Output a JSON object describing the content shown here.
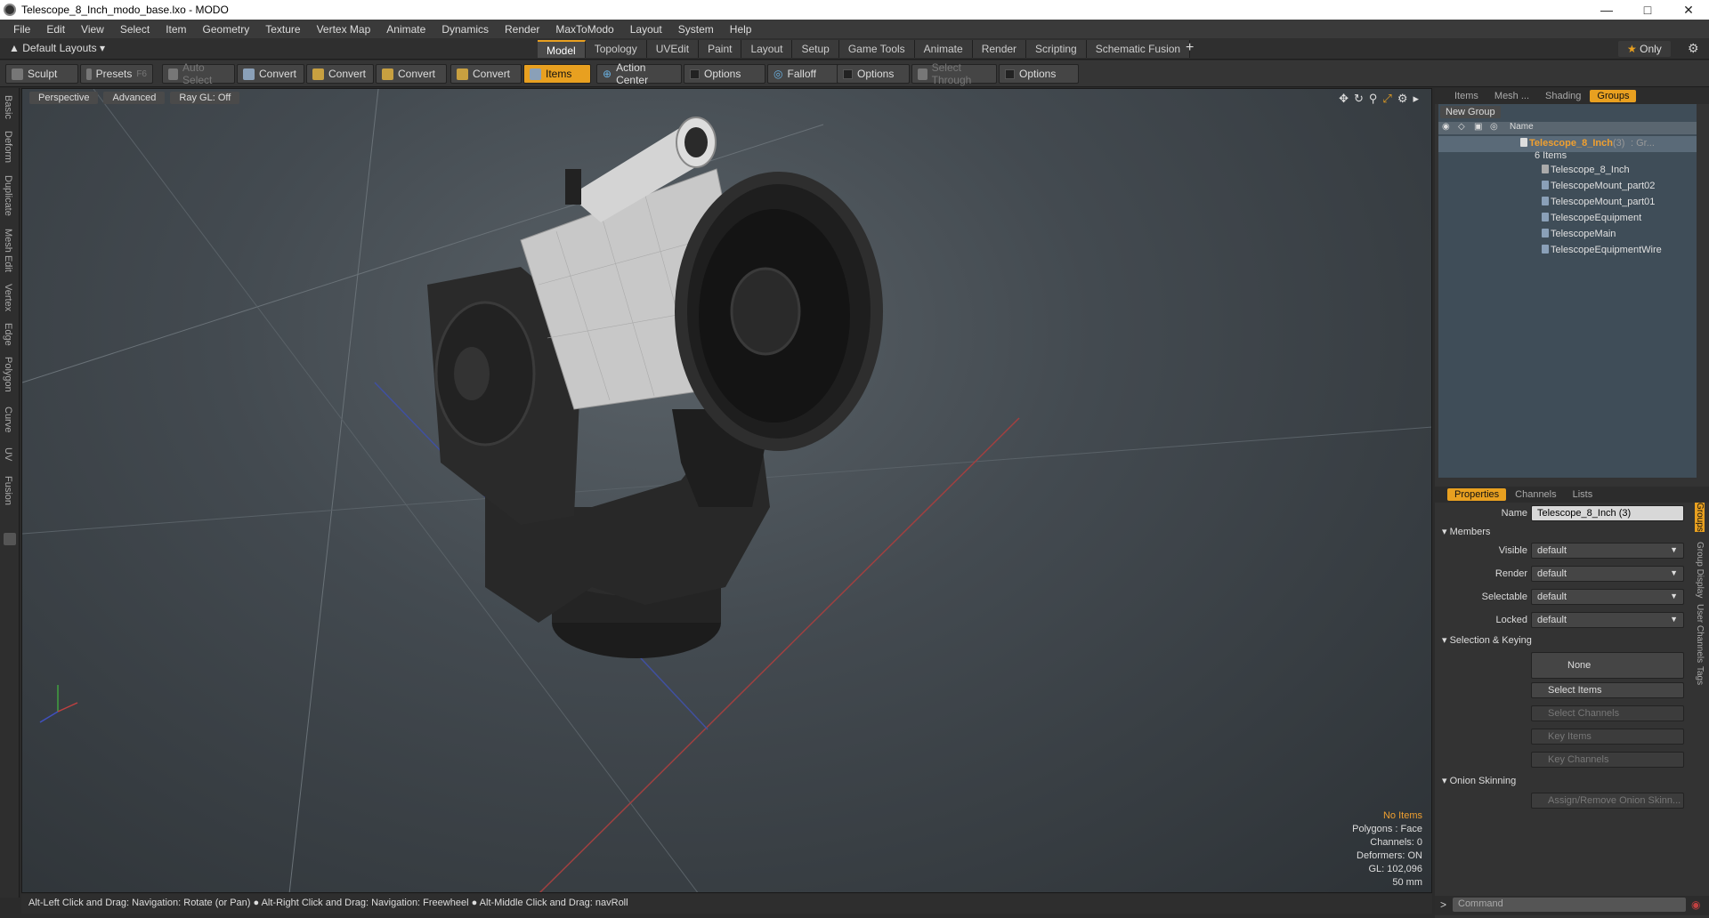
{
  "window": {
    "title": "Telescope_8_Inch_modo_base.lxo - MODO"
  },
  "menu": [
    "File",
    "Edit",
    "View",
    "Select",
    "Item",
    "Geometry",
    "Texture",
    "Vertex Map",
    "Animate",
    "Dynamics",
    "Render",
    "MaxToModo",
    "Layout",
    "System",
    "Help"
  ],
  "layouts": {
    "default_label": "Default Layouts",
    "tabs": [
      "Model",
      "Topology",
      "UVEdit",
      "Paint",
      "Layout",
      "Setup",
      "Game Tools",
      "Animate",
      "Render",
      "Scripting",
      "Schematic Fusion"
    ],
    "active_tab": "Model",
    "only_label": "Only"
  },
  "toolbar": {
    "sculpt": "Sculpt",
    "presets": "Presets",
    "presets_key": "F6",
    "auto_select": "Auto Select",
    "convert": "Convert",
    "items": "Items",
    "action_center": "Action Center",
    "options": "Options",
    "falloff": "Falloff",
    "select_through": "Select Through"
  },
  "left_tabs": [
    "Basic",
    "Deform",
    "Duplicate",
    "Mesh Edit",
    "Vertex",
    "Edge",
    "Polygon",
    "Curve",
    "UV",
    "Fusion"
  ],
  "viewport": {
    "view_mode": "Perspective",
    "advanced": "Advanced",
    "raygl": "Ray GL: Off",
    "info": {
      "selection": "No Items",
      "polygons": "Polygons : Face",
      "channels": "Channels: 0",
      "deformers": "Deformers: ON",
      "gl": "GL: 102,096",
      "scale": "50 mm"
    }
  },
  "status": "Alt-Left Click and Drag: Navigation: Rotate (or Pan) ● Alt-Right Click and Drag: Navigation: Freewheel ● Alt-Middle Click and Drag: navRoll",
  "panel_top": {
    "tabs": [
      "Items",
      "Mesh ...",
      "Shading",
      "Groups"
    ],
    "active": "Groups",
    "new_group": "New Group",
    "col_name": "Name",
    "group_name": "Telescope_8_Inch",
    "group_count": "(3)",
    "group_suffix": ": Gr...",
    "items_count": "6 Items",
    "items": [
      "Telescope_8_Inch",
      "TelescopeMount_part02",
      "TelescopeMount_part01",
      "TelescopeEquipment",
      "TelescopeMain",
      "TelescopeEquipmentWire"
    ]
  },
  "panel_props": {
    "tabs": [
      "Properties",
      "Channels",
      "Lists"
    ],
    "active": "Properties",
    "name_label": "Name",
    "name_value": "Telescope_8_Inch (3)",
    "members": "Members",
    "visible_label": "Visible",
    "render_label": "Render",
    "selectable_label": "Selectable",
    "locked_label": "Locked",
    "default_value": "default",
    "sel_keying": "Selection & Keying",
    "none": "None",
    "select_items": "Select Items",
    "select_channels": "Select Channels",
    "key_items": "Key Items",
    "key_channels": "Key Channels",
    "onion": "Onion Skinning",
    "assign_onion": "Assign/Remove Onion Skinn...",
    "side_tabs": [
      "Groups",
      "Group Display",
      "User Channels",
      "Tags"
    ]
  },
  "command": {
    "placeholder": "Command"
  },
  "colors": {
    "accent": "#e8a020",
    "viewport_bg": "#434a50"
  }
}
